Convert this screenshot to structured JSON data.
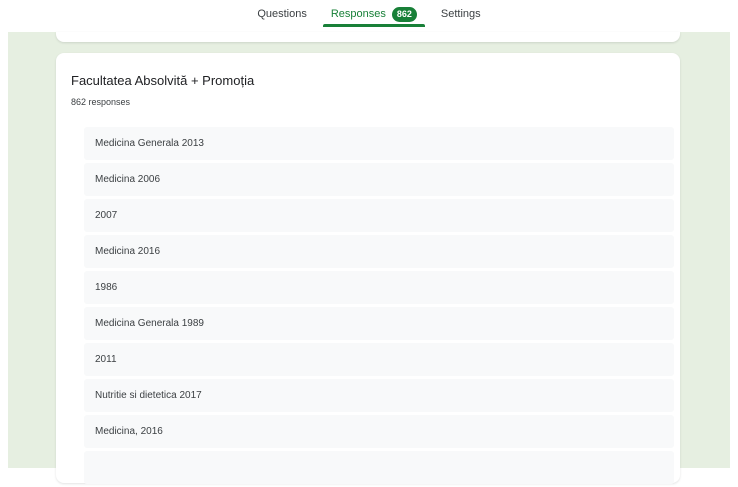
{
  "tabs": [
    {
      "label": "Questions"
    },
    {
      "label": "Responses",
      "badge": "862"
    },
    {
      "label": "Settings"
    }
  ],
  "question": {
    "title": "Facultatea Absolvită + Promoția",
    "count_text": "862 responses"
  },
  "responses": [
    "Medicina Generala 2013",
    "Medicina 2006",
    "2007",
    "Medicina 2016",
    "1986",
    "Medicina Generala 1989",
    "2011",
    "Nutritie si dietetica 2017",
    "Medicina, 2016",
    ""
  ],
  "colors": {
    "accent": "#188038",
    "background": "#e6efe1",
    "row": "#f8f9fa"
  }
}
